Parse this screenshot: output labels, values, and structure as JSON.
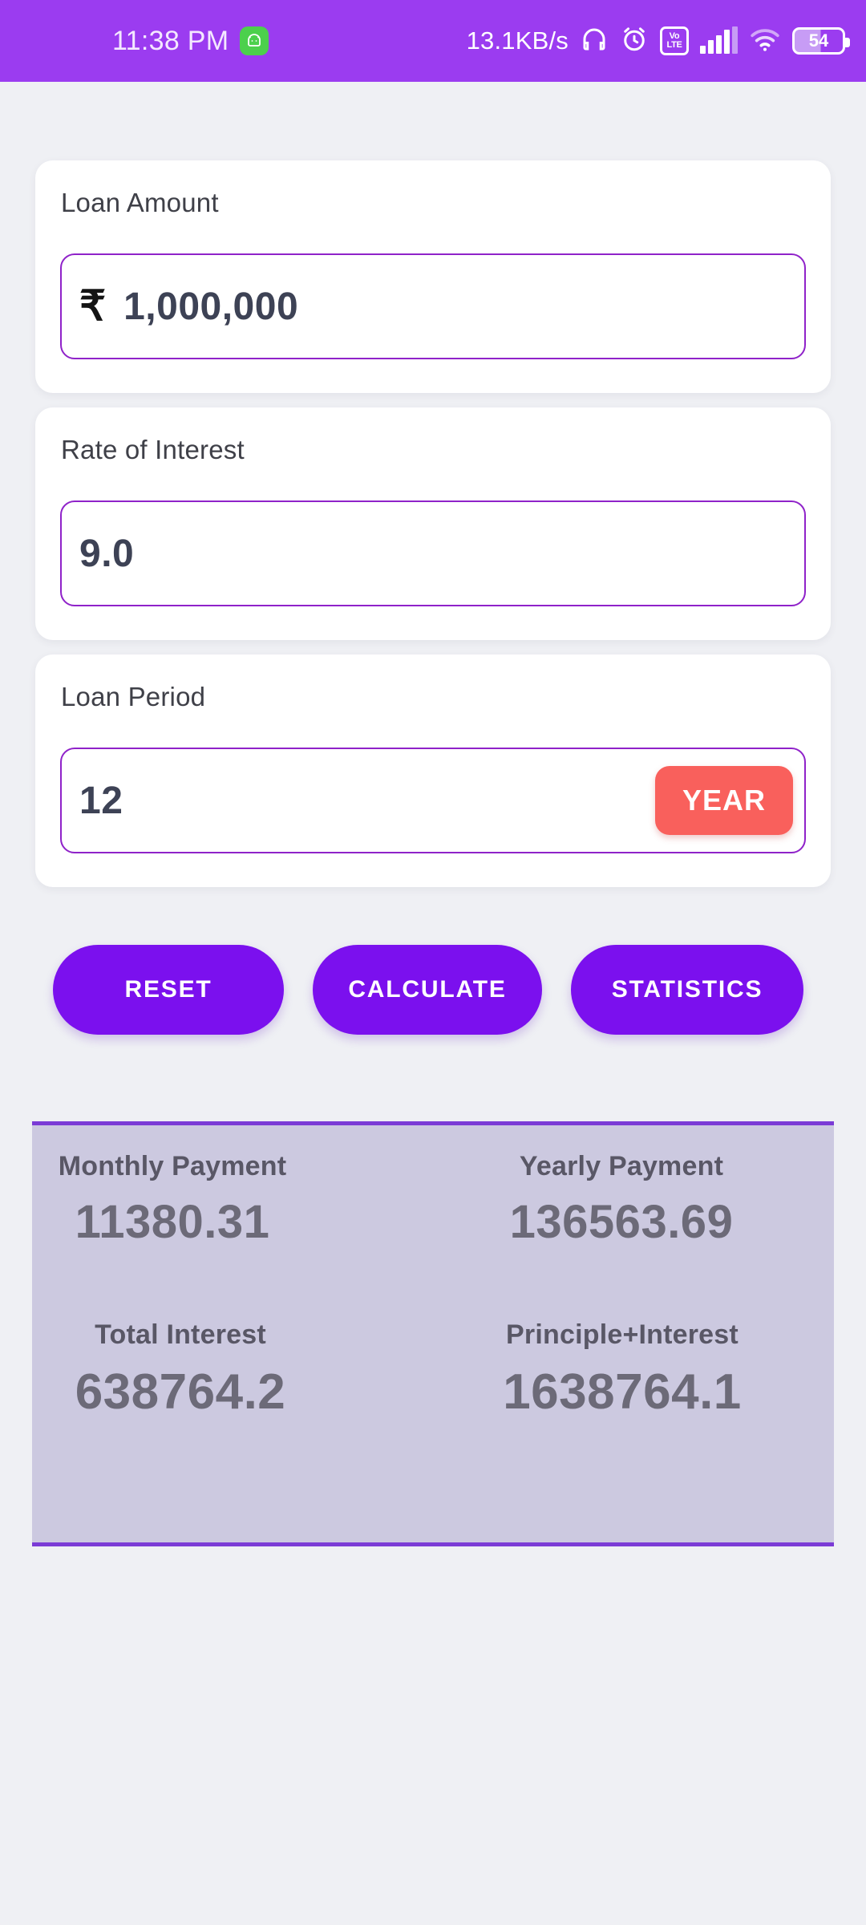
{
  "status_bar": {
    "clock": "11:38 PM",
    "app_icon": "android-head-icon",
    "network_speed": "13.1KB/s",
    "headphone_icon": "headphones-icon",
    "alarm_icon": "alarm-clock-icon",
    "volte_top": "Vo",
    "volte_bottom": "LTE",
    "signal_icon": "signal-bars-icon",
    "wifi_icon": "wifi-icon",
    "battery_level": "54",
    "background_color": "#9b3cf0"
  },
  "form": {
    "loan_amount": {
      "label": "Loan Amount",
      "currency_symbol": "₹",
      "value": "1,000,000"
    },
    "rate_of_interest": {
      "label": "Rate of Interest",
      "value": "9.0"
    },
    "loan_period": {
      "label": "Loan Period",
      "value": "12",
      "unit_label": "YEAR",
      "unit_color": "#f9605c"
    }
  },
  "actions": {
    "reset_label": "RESET",
    "calculate_label": "CALCULATE",
    "statistics_label": "STATISTICS",
    "button_color": "#7b10ee"
  },
  "results": {
    "panel_color": "#ccc9e0",
    "border_color": "#7b3bd6",
    "monthly_payment": {
      "label": "Monthly Payment",
      "value": "11380.31"
    },
    "yearly_payment": {
      "label": "Yearly Payment",
      "value": "136563.69"
    },
    "total_interest": {
      "label": "Total Interest",
      "value": "638764.2"
    },
    "principle_plus_interest": {
      "label": "Principle+Interest",
      "value": "1638764.1"
    }
  }
}
